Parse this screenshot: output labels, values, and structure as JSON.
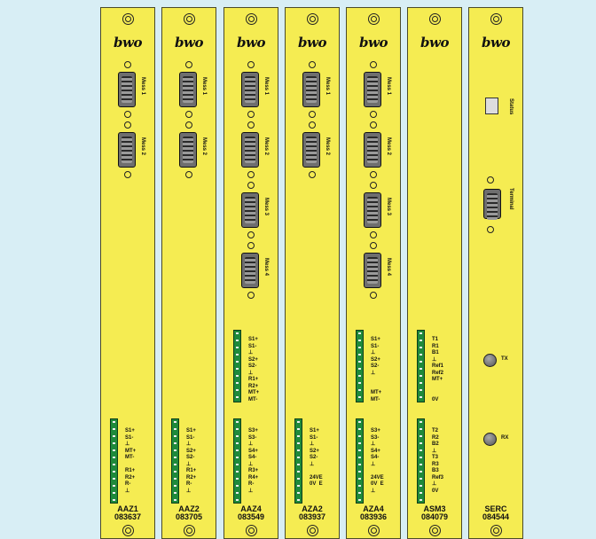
{
  "brand": "bwo",
  "cards": [
    {
      "name": "AAZ1",
      "code": "083637",
      "mess": [
        "Mess 1",
        "Mess 2"
      ],
      "pins_top": "",
      "pins_bottom": "S1+\nS1-\n⊥\nMT+\nMT-\n\nR1+\nR2+\nR-\n⊥"
    },
    {
      "name": "AAZ2",
      "code": "083705",
      "mess": [
        "Mess 1",
        "Mess 2"
      ],
      "pins_top": "",
      "pins_bottom": "S1+\nS1-\n⊥\nS2+\nS2-\n⊥\nR1+\nR2+\nR-\n⊥"
    },
    {
      "name": "AAZ4",
      "code": "083549",
      "mess": [
        "Mess 1",
        "Mess 2",
        "Mess 3",
        "Mess 4"
      ],
      "pins_top": "S1+\nS1-\n⊥\nS2+\nS2-\n⊥\nR1+\nR2+\nMT+\nMT-",
      "pins_bottom": "S3+\nS3-\n⊥\nS4+\nS4-\n⊥\nR3+\nR4+\nR-\n⊥"
    },
    {
      "name": "AZA2",
      "code": "083937",
      "mess": [
        "Mess 1",
        "Mess 2"
      ],
      "pins_top": "",
      "pins_bottom": "S1+\nS1-\n⊥\nS2+\nS2-\n⊥\n\n24VE\n0V  E\n"
    },
    {
      "name": "AZA4",
      "code": "083936",
      "mess": [
        "Mess 1",
        "Mess 2",
        "Mess 3",
        "Mess 4"
      ],
      "pins_top": "S1+\nS1-\n⊥\nS2+\nS2-\n⊥\n\n\nMT+\nMT-",
      "pins_bottom": "S3+\nS3-\n⊥\nS4+\nS4-\n⊥\n\n24VE\n0V  E\n⊥"
    },
    {
      "name": "ASM3",
      "code": "084079",
      "mess": [],
      "pins_top": "T1\nR1\nB1\n⊥\nRef1\nRef2\nMT+\n\n\n0V",
      "pins_bottom": "T2\nR2\nB2\n⊥\nT3\nR3\nB3\nRef3\n⊥\n0V"
    },
    {
      "name": "SERC",
      "code": "084544",
      "status": "Status",
      "terminal": "Terminal",
      "tx": "TX",
      "rx": "RX"
    }
  ]
}
